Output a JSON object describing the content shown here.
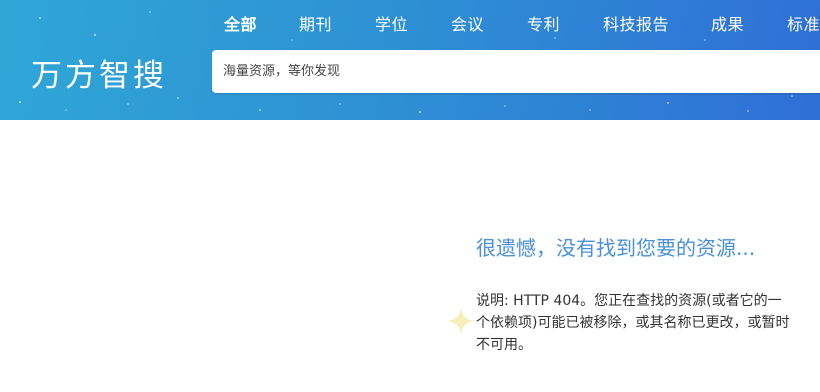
{
  "header": {
    "logo": "万方智搜",
    "nav": [
      {
        "label": "全部",
        "active": true
      },
      {
        "label": "期刊",
        "active": false
      },
      {
        "label": "学位",
        "active": false
      },
      {
        "label": "会议",
        "active": false
      },
      {
        "label": "专利",
        "active": false
      },
      {
        "label": "科技报告",
        "active": false
      },
      {
        "label": "成果",
        "active": false
      },
      {
        "label": "标准",
        "active": false
      }
    ],
    "search_placeholder": "海量资源，等你发现"
  },
  "error": {
    "title": "很遗憾，没有找到您要的资源...",
    "description": "说明: HTTP 404。您正在查找的资源(或者它的一个依赖项)可能已被移除，或其名称已更改，或暂时不可用。"
  },
  "colors": {
    "header_start": "#2fa6d6",
    "header_end": "#2f6fd6",
    "title_blue": "#4a90d9",
    "sparkle": "#f6f0b8"
  },
  "icons": {
    "sparkle": "sparkle-icon"
  }
}
